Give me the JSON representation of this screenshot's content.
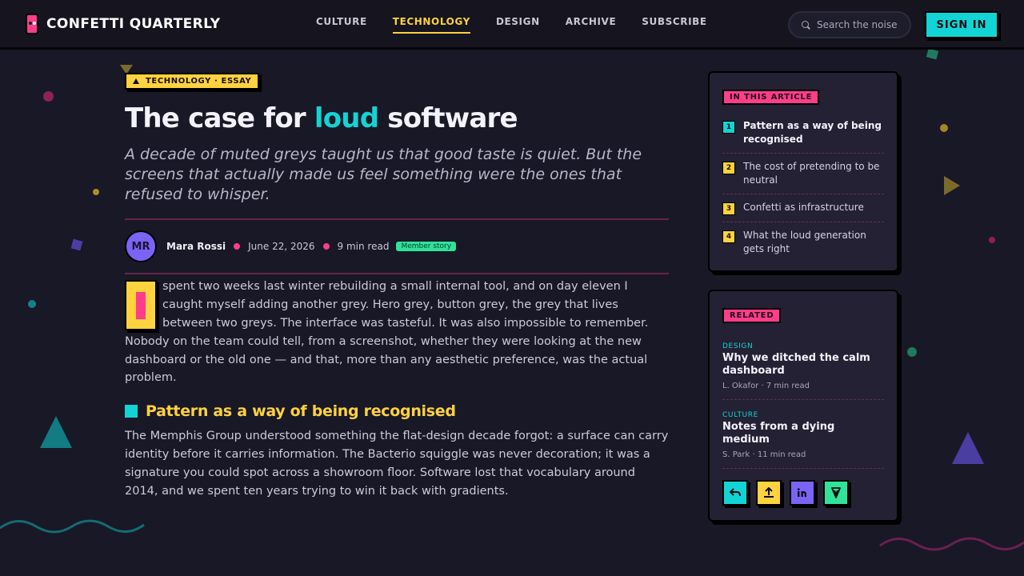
{
  "header": {
    "brand": "CONFETTI QUARTERLY",
    "nav": [
      {
        "label": "CULTURE",
        "active": false
      },
      {
        "label": "TECHNOLOGY",
        "active": true
      },
      {
        "label": "DESIGN",
        "active": false
      },
      {
        "label": "ARCHIVE",
        "active": false
      },
      {
        "label": "SUBSCRIBE",
        "active": false
      }
    ],
    "search_placeholder": "Search the noise",
    "signin_label": "SIGN IN"
  },
  "article": {
    "kicker": "TECHNOLOGY · ESSAY",
    "title_pre": "The case for ",
    "title_accent": "loud",
    "title_post": " software",
    "dek": "A decade of muted greys taught us that good taste is quiet. But the screens that actually made us feel something were the ones that refused to whisper.",
    "author_initials": "MR",
    "author": "Mara Rossi",
    "date": "June 22, 2026",
    "read_time": "9 min read",
    "badge": "Member story",
    "dropcap_letter": "I",
    "p1": "spent two weeks last winter rebuilding a small internal tool, and on day eleven I caught myself adding another grey. Hero grey, button grey, the grey that lives between two greys. The interface was tasteful. It was also impossible to remember. Nobody on the team could tell, from a screenshot, whether they were looking at the new dashboard or the old one — and that, more than any aesthetic preference, was the actual problem.",
    "h2": "Pattern as a way of being recognised",
    "p2": "The Memphis Group understood something the flat-design decade forgot: a surface can carry identity before it carries information. The Bacterio squiggle was never decoration; it was a signature you could spot across a showroom floor. Software lost that vocabulary around 2014, and we spent ten years trying to win it back with gradients."
  },
  "sidebar": {
    "toc_label": "IN THIS ARTICLE",
    "toc": [
      {
        "num": "1",
        "text": "Pattern as a way of being recognised",
        "color": "#13d4d4"
      },
      {
        "num": "2",
        "text": "The cost of pretending to be neutral",
        "color": "#ffd23f"
      },
      {
        "num": "3",
        "text": "Confetti as infrastructure",
        "color": "#ffd23f"
      },
      {
        "num": "4",
        "text": "What the loud generation gets right",
        "color": "#ffd23f"
      }
    ],
    "related_label": "RELATED",
    "related": [
      {
        "category": "DESIGN",
        "title": "Why we ditched the calm dashboard",
        "meta": "L. Okafor · 7 min read"
      },
      {
        "category": "CULTURE",
        "title": "Notes from a dying medium",
        "meta": "S. Park · 11 min read"
      }
    ],
    "share": [
      {
        "icon": "reply-arrow-icon",
        "color": "#13d4d4"
      },
      {
        "icon": "upload-icon",
        "color": "#ffd23f"
      },
      {
        "icon": "linkedin-icon",
        "color": "#7b63f5"
      },
      {
        "icon": "vee-icon",
        "color": "#2fe39a"
      }
    ]
  }
}
